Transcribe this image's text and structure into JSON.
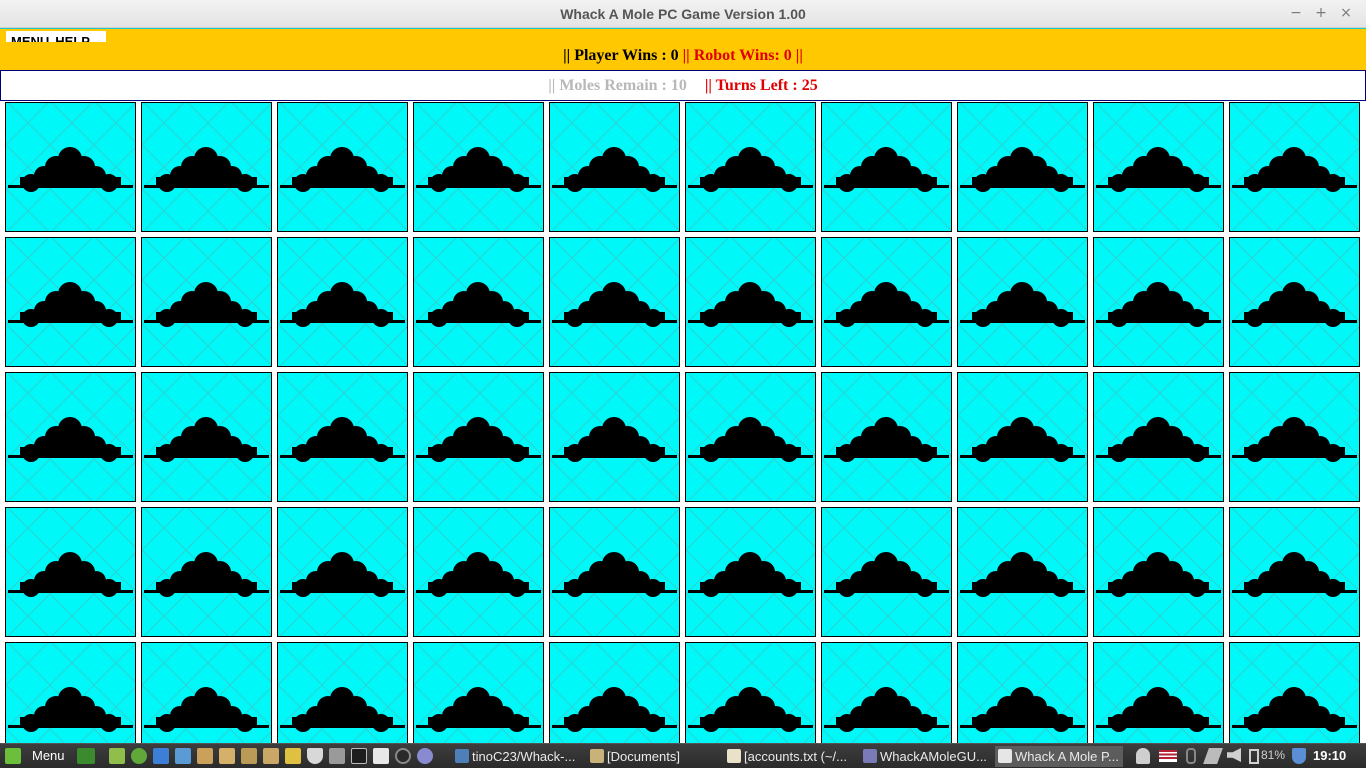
{
  "window": {
    "title": "Whack A Mole PC Game Version 1.00",
    "controls": {
      "minimize": "−",
      "maximize": "+",
      "close": "×"
    }
  },
  "app_menu": {
    "items": [
      "MENU",
      "HELP"
    ]
  },
  "scorebar": {
    "player_wins": "|| Player Wins :  0",
    "robot_wins": "|| Robot Wins:  0 ||"
  },
  "status": {
    "moles_remain": "|| Moles Remain : 10",
    "turns_left": "|| Turns Left : 25"
  },
  "board": {
    "rows": 5,
    "columns": 10,
    "cell_icon": "mole-hill-icon",
    "cell_color": "#00f8f8",
    "mound_color": "#000000"
  },
  "taskbar": {
    "menu_label": "Menu",
    "tasks": [
      {
        "label": "tinoC23/Whack-...",
        "icon": "browser-icon",
        "active": false
      },
      {
        "label": "[Documents]",
        "icon": "folder-icon",
        "active": false
      },
      {
        "label": "[accounts.txt (~/...",
        "icon": "text-editor-icon",
        "active": false
      },
      {
        "label": "WhackAMoleGU...",
        "icon": "ide-icon",
        "active": false
      },
      {
        "label": "Whack A Mole P...",
        "icon": "java-icon",
        "active": true
      }
    ],
    "tray": {
      "battery": "81%",
      "clock": "19:10"
    }
  },
  "colors": {
    "accent": "#ffc800",
    "robot_text": "#e00000",
    "cell": "#00f8f8"
  }
}
